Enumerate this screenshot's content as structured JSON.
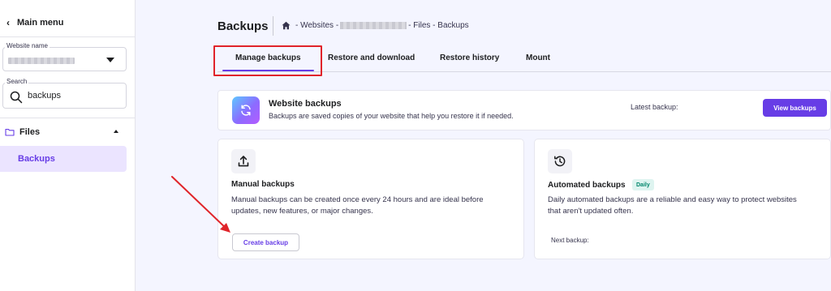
{
  "sidebar": {
    "main_menu": "Main menu",
    "website_name_label": "Website name",
    "search_label": "Search",
    "search_value": "backups",
    "files_label": "Files",
    "backups_label": "Backups"
  },
  "header": {
    "title": "Backups",
    "breadcrumb_prefix": "- Websites -",
    "breadcrumb_suffix": "- Files - Backups"
  },
  "tabs": [
    {
      "label": "Manage backups",
      "active": true
    },
    {
      "label": "Restore and download",
      "active": false
    },
    {
      "label": "Restore history",
      "active": false
    },
    {
      "label": "Mount",
      "active": false
    }
  ],
  "website_backups": {
    "title": "Website backups",
    "description": "Backups are saved copies of your website that help you restore it if needed.",
    "latest_backup_label": "Latest backup:",
    "view_button": "View backups"
  },
  "manual": {
    "title": "Manual backups",
    "description": "Manual backups can be created once every 24 hours and are ideal before updates, new features, or major changes.",
    "create_button": "Create backup"
  },
  "automated": {
    "title": "Automated backups",
    "badge": "Daily",
    "description": "Daily automated backups are a reliable and easy way to protect websites that aren't updated often.",
    "next_backup_label": "Next backup:"
  },
  "colors": {
    "accent": "#673de6",
    "annotation": "#e0242a",
    "badge_bg": "#def4f0",
    "badge_text": "#00866b"
  }
}
